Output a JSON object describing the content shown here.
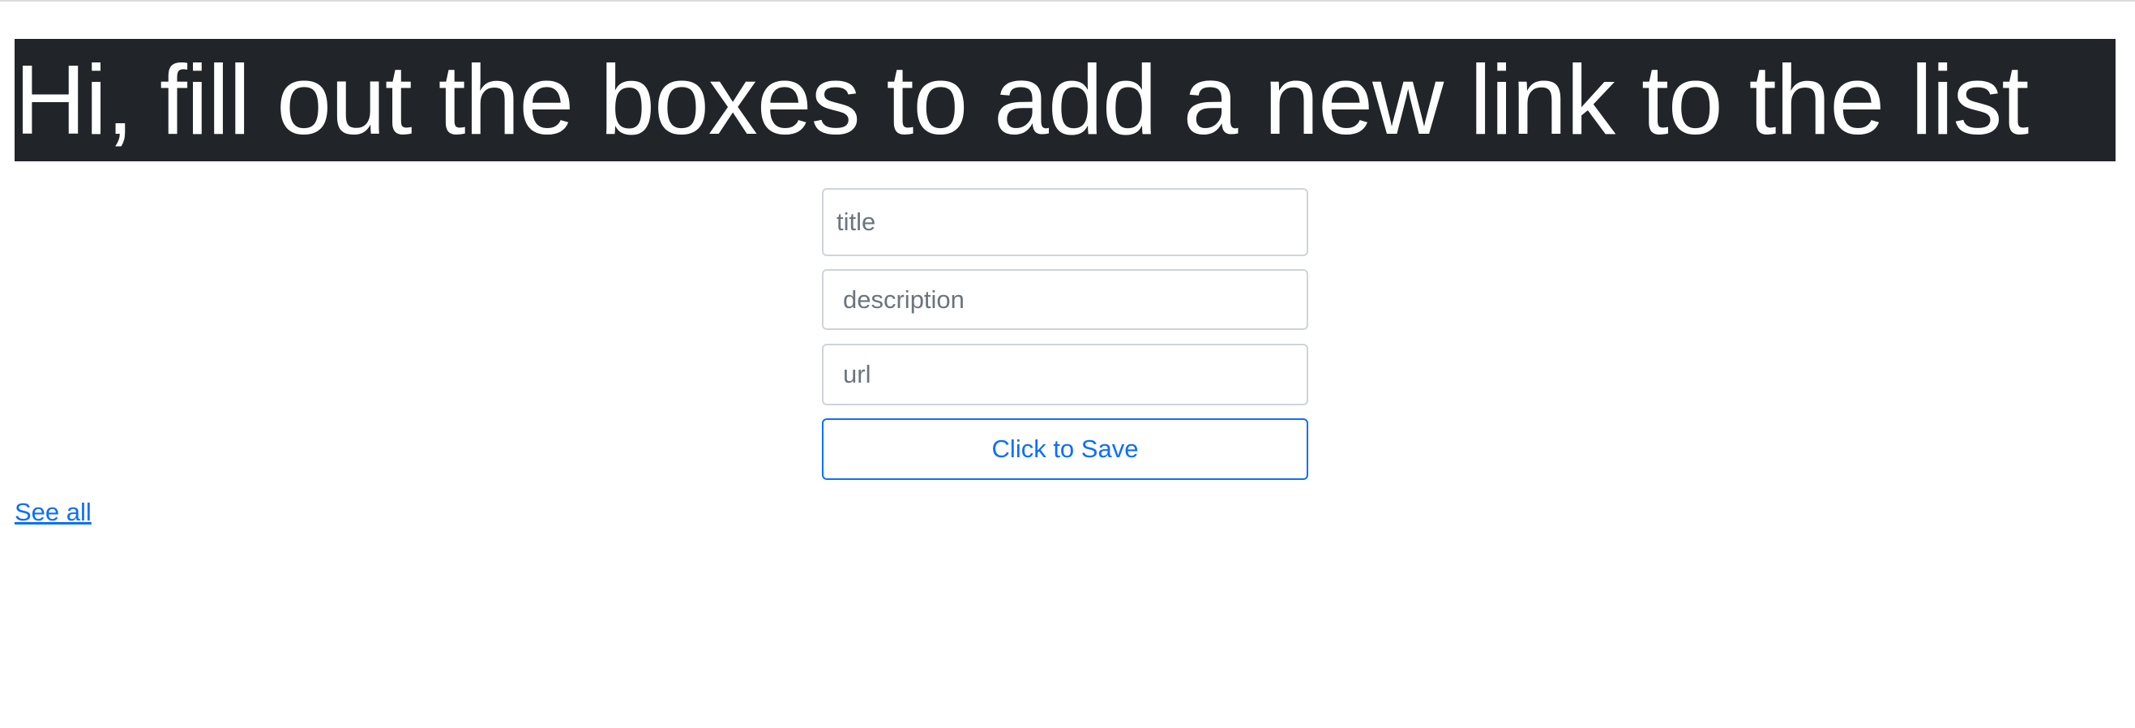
{
  "header": {
    "heading": "Hi, fill out the boxes to add a new link to the list"
  },
  "form": {
    "title_placeholder": "title",
    "description_placeholder": "description",
    "url_placeholder": "url",
    "save_label": "Click to Save"
  },
  "links": {
    "see_all": "See all"
  },
  "colors": {
    "hero_background": "#212529",
    "hero_text": "#ffffff",
    "accent": "#0d6efd",
    "input_border": "#ced4da",
    "placeholder": "#6c757d"
  }
}
